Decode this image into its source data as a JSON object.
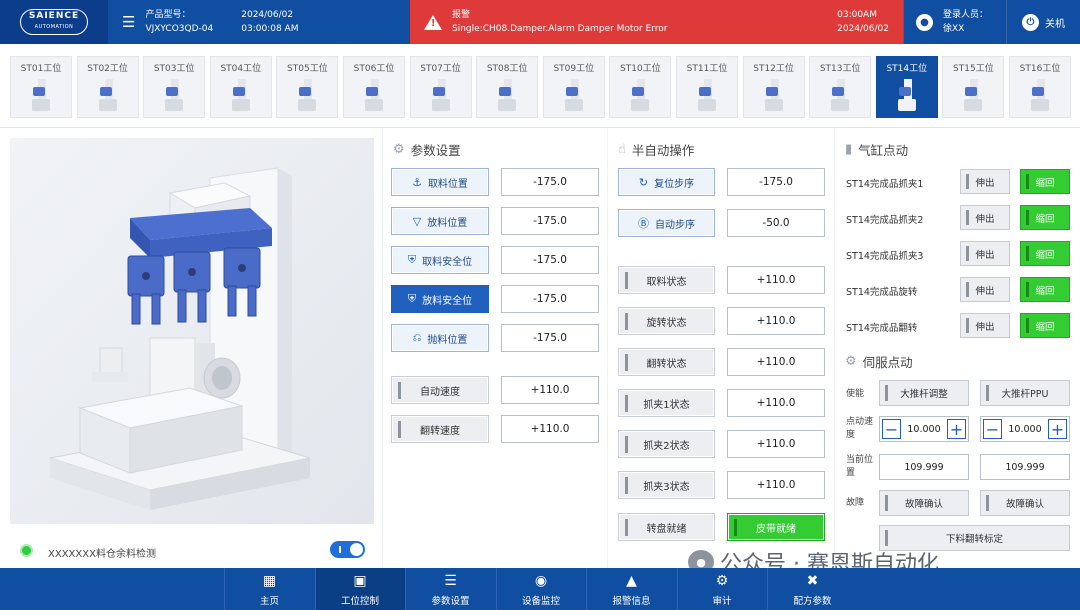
{
  "header": {
    "logo": "SAIENCE",
    "logo_sub": "AUTOMATION",
    "product_label": "产品型号：",
    "product_value": "VJXYCO3QD-04",
    "product_date": "2024/06/02",
    "product_time": "03:00:08 AM",
    "alarm_label": "报警",
    "alarm_message": "Single:CH08.Damper.Alarm Damper Motor Error",
    "alarm_time": "03:00AM",
    "alarm_date": "2024/06/02",
    "user_label": "登录人员：",
    "user_name": "徐XX",
    "power_label": "关机"
  },
  "stations": [
    "ST01工位",
    "ST02工位",
    "ST03工位",
    "ST04工位",
    "ST05工位",
    "ST06工位",
    "ST07工位",
    "ST08工位",
    "ST09工位",
    "ST10工位",
    "ST11工位",
    "ST12工位",
    "ST13工位",
    "ST14工位",
    "ST15工位",
    "ST16工位"
  ],
  "active_station": "ST14工位",
  "left_panel": {
    "detect_label": "XXXXXXX料仓余料检测"
  },
  "params": {
    "title": "参数设置",
    "rows": [
      {
        "label": "取料位置",
        "icon": "pick-icon",
        "value": "-175.0"
      },
      {
        "label": "放料位置",
        "icon": "place-icon",
        "value": "-175.0"
      },
      {
        "label": "取料安全位",
        "icon": "shield-icon",
        "value": "-175.0"
      },
      {
        "label": "放料安全位",
        "icon": "shield-icon",
        "value": "-175.0"
      },
      {
        "label": "抛料位置",
        "icon": "throw-icon",
        "value": "-175.0"
      },
      {
        "label": "自动速度",
        "value": "+110.0"
      },
      {
        "label": "翻转速度",
        "value": "+110.0"
      }
    ]
  },
  "semi_auto": {
    "title": "半自动操作",
    "rows": [
      {
        "label": "复位步序",
        "value": "-175.0"
      },
      {
        "label": "自动步序",
        "value": "-50.0"
      },
      {
        "label": "取料状态",
        "value": "+110.0"
      },
      {
        "label": "旋转状态",
        "value": "+110.0"
      },
      {
        "label": "翻转状态",
        "value": "+110.0"
      },
      {
        "label": "抓夹1状态",
        "value": "+110.0"
      },
      {
        "label": "抓夹2状态",
        "value": "+110.0"
      },
      {
        "label": "抓夹3状态",
        "value": "+110.0"
      }
    ],
    "turntable_ready": "转盘就绪",
    "belt_ready": "皮带就绪"
  },
  "cylinders": {
    "title": "气缸点动",
    "extend_label": "伸出",
    "retract_label": "缩回",
    "rows": [
      "ST14完成品抓夹1",
      "ST14完成品抓夹2",
      "ST14完成品抓夹3",
      "ST14完成品旋转",
      "ST14完成品翻转"
    ]
  },
  "servo": {
    "title": "伺服点动",
    "enable_label": "使能",
    "enable_buttons": [
      "大推杆调整",
      "大推杆PPU"
    ],
    "jog_speed_label": "点动速度",
    "jog_speed_values": [
      "10.000",
      "10.000"
    ],
    "position_label": "当前位置",
    "position_values": [
      "109.999",
      "109.999"
    ],
    "fault_label": "故障",
    "fault_buttons": [
      "故障确认",
      "故障确认"
    ],
    "calibrate_label": "下料翻转标定"
  },
  "nav": {
    "items": [
      {
        "label": "主页",
        "icon": "home-icon"
      },
      {
        "label": "工位控制",
        "icon": "monitor-icon"
      },
      {
        "label": "参数设置",
        "icon": "sliders-icon"
      },
      {
        "label": "设备监控",
        "icon": "camera-icon"
      },
      {
        "label": "报警信息",
        "icon": "alarm-icon"
      },
      {
        "label": "审计",
        "icon": "audit-icon"
      },
      {
        "label": "配方参数",
        "icon": "recipe-icon"
      }
    ]
  },
  "watermark": "公众号 · 赛恩斯自动化"
}
